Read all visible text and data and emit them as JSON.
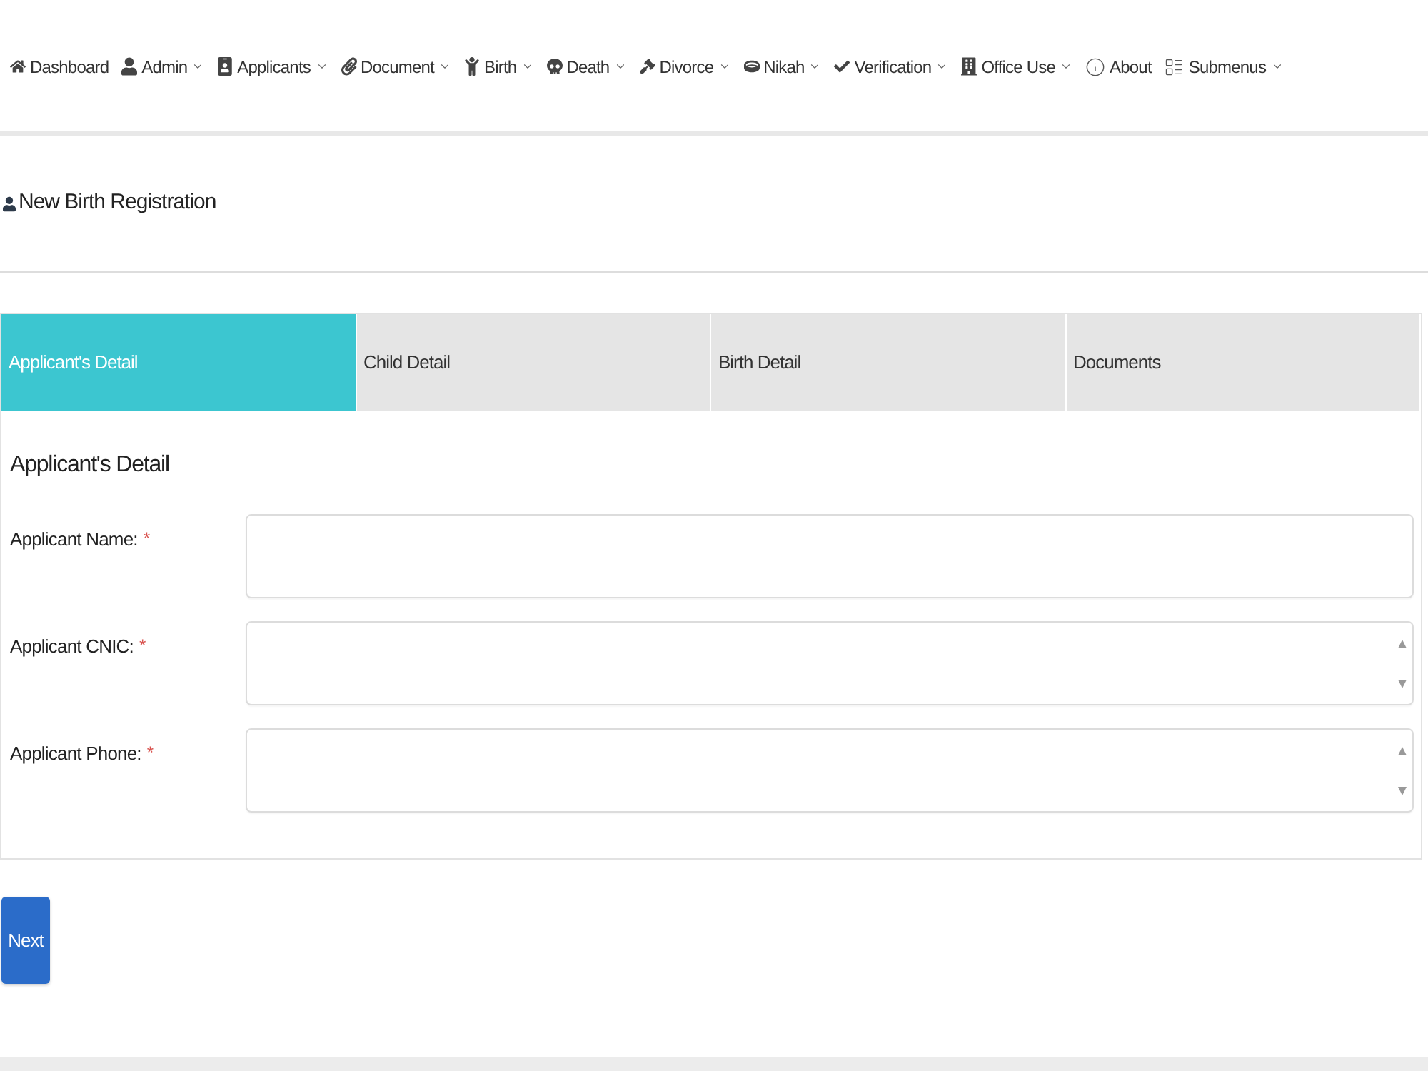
{
  "nav": {
    "items": [
      {
        "label": "Dashboard",
        "dropdown": false
      },
      {
        "label": "Admin",
        "dropdown": true
      },
      {
        "label": "Applicants",
        "dropdown": true
      },
      {
        "label": "Document",
        "dropdown": true
      },
      {
        "label": "Birth",
        "dropdown": true
      },
      {
        "label": "Death",
        "dropdown": true
      },
      {
        "label": "Divorce",
        "dropdown": true
      },
      {
        "label": "Nikah",
        "dropdown": true
      },
      {
        "label": "Verification",
        "dropdown": true
      },
      {
        "label": "Office Use",
        "dropdown": true
      },
      {
        "label": "About",
        "dropdown": false
      },
      {
        "label": "Submenus",
        "dropdown": true
      }
    ]
  },
  "page_header": {
    "title": "New Birth Registration"
  },
  "tabs": [
    {
      "label": "Applicant's Detail",
      "selected": true
    },
    {
      "label": "Child Detail",
      "selected": false
    },
    {
      "label": "Birth Detail",
      "selected": false
    },
    {
      "label": "Documents",
      "selected": false
    }
  ],
  "section": {
    "title": "Applicant's Detail",
    "fields": [
      {
        "label": "Applicant Name:",
        "required_mark": "*",
        "kind": "text"
      },
      {
        "label": "Applicant CNIC:",
        "required_mark": "*",
        "kind": "number"
      },
      {
        "label": "Applicant Phone:",
        "required_mark": "*",
        "kind": "number"
      }
    ]
  },
  "buttons": {
    "next": "Next"
  }
}
